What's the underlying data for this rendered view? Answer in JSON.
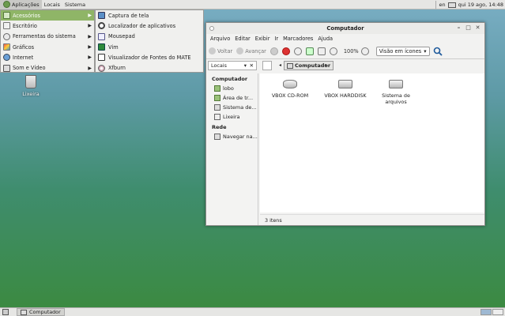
{
  "top_panel": {
    "menus": [
      "Aplicações",
      "Locais",
      "Sistema"
    ],
    "keyboard_layout": "en",
    "clock": "qui 19 ago, 14:48"
  },
  "app_menu": {
    "categories": [
      {
        "label": "Acessórios",
        "icon": "accessories-icon",
        "selected": true
      },
      {
        "label": "Escritório",
        "icon": "office-icon"
      },
      {
        "label": "Ferramentas do sistema",
        "icon": "system-tools-icon"
      },
      {
        "label": "Gráficos",
        "icon": "graphics-icon"
      },
      {
        "label": "Internet",
        "icon": "internet-icon"
      },
      {
        "label": "Som e Vídeo",
        "icon": "multimedia-icon"
      }
    ],
    "submenu": [
      {
        "label": "Captura de tela",
        "icon": "screenshot-icon"
      },
      {
        "label": "Localizador de aplicativos",
        "icon": "search-icon"
      },
      {
        "label": "Mousepad",
        "icon": "text-editor-icon"
      },
      {
        "label": "Vim",
        "icon": "vim-icon"
      },
      {
        "label": "Visualizador de Fontes do MATE",
        "icon": "font-viewer-icon"
      },
      {
        "label": "Xfburn",
        "icon": "disc-burner-icon"
      }
    ]
  },
  "desktop": {
    "trash_label": "Lixeira"
  },
  "window": {
    "title": "Computador",
    "menubar": [
      "Arquivo",
      "Editar",
      "Exibir",
      "Ir",
      "Marcadores",
      "Ajuda"
    ],
    "toolbar": {
      "back": "Voltar",
      "forward": "Avançar",
      "zoom": "100%",
      "view_mode": "Visão em ícones"
    },
    "location_combo": "Locais",
    "breadcrumb": "Computador",
    "sidebar": {
      "sections": [
        {
          "heading": "Computador",
          "items": [
            "lobo",
            "Área de tr...",
            "Sistema de...",
            "Lixeira"
          ]
        },
        {
          "heading": "Rede",
          "items": [
            "Navegar na..."
          ]
        }
      ]
    },
    "items": [
      "VBOX CD-ROM",
      "VBOX HARDDISK",
      "Sistema de arquivos"
    ],
    "status": "3 itens"
  },
  "bottom_panel": {
    "task_label": "Computador"
  },
  "colors": {
    "menu_highlight": "#8fb567",
    "panel": "#e6e6e4"
  }
}
